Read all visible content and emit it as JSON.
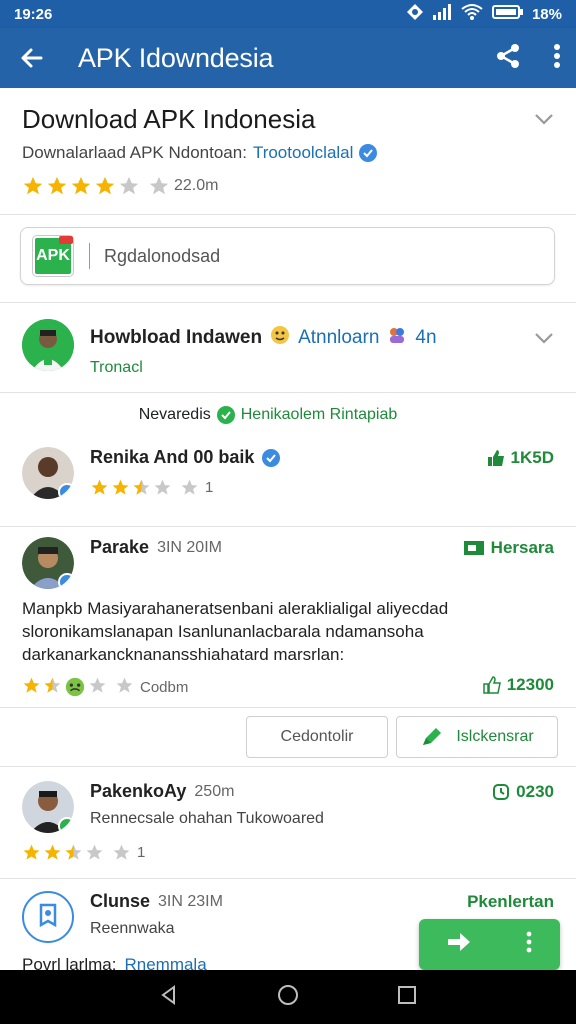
{
  "status_bar": {
    "time": "19:26",
    "battery_text": "18%",
    "status_icons": [
      "location-icon",
      "signal-icon",
      "wifi-icon",
      "battery-icon"
    ]
  },
  "app_bar": {
    "title": "APK Idowndesia",
    "actions": [
      "share-icon",
      "more-vert-icon"
    ]
  },
  "header": {
    "title": "Download APK Indonesia",
    "subtitle": "Downalarlaad APK Ndontoan:",
    "publisher": "Trootoolclalal",
    "rating_text": "22.0m",
    "stars": 4
  },
  "search": {
    "text": "Rgdalonodsad",
    "logo_text": "APK"
  },
  "developer": {
    "name": "Howbload Indawen",
    "link": "Atnnloarn",
    "extra": "4n",
    "sub": "Tronacl"
  },
  "reviews_header": {
    "label": "Nevaredis",
    "highlight": "Henikaolem Rintapiab"
  },
  "reviews": [
    {
      "name": "Renika And 00 baik",
      "time": "",
      "right_label": "1K5D",
      "text": "",
      "stars": 2.5,
      "count": "1",
      "sub": ""
    },
    {
      "name": "Parake",
      "time": "3IN 20IM",
      "right_label": "Hersara",
      "text": "Manpkb Masiyarahaneratsenbani aleraklialigal aliyecdad sloronikamslanapan Isanlunanlacbarala ndamansoha darkanarkancknanansshiahatard marsrlan:",
      "stars": 1.5,
      "count": "Codbm",
      "like_count": "12300",
      "sub": ""
    },
    {
      "name": "PakenkoAy",
      "time": "250m",
      "right_label": "0230",
      "text": "",
      "stars": 2.5,
      "count": "1",
      "sub": "Rennecsale ohahan Tukowoared"
    },
    {
      "name": "Clunse",
      "time": "3IN 23IM",
      "right_label": "Pkenlertan",
      "text": "",
      "stars": 0,
      "count": "",
      "sub": "Reennwaka",
      "extra_label": "Povrl larlma:",
      "extra_link": "Rnemmala"
    }
  ],
  "review_actions": {
    "secondary": "Cedontolir",
    "primary": "Islckensrar"
  },
  "colors": {
    "app_bar": "#2563a8",
    "accent_green": "#2bb24c",
    "link_blue": "#1a6fb5",
    "star": "#f6b400"
  }
}
